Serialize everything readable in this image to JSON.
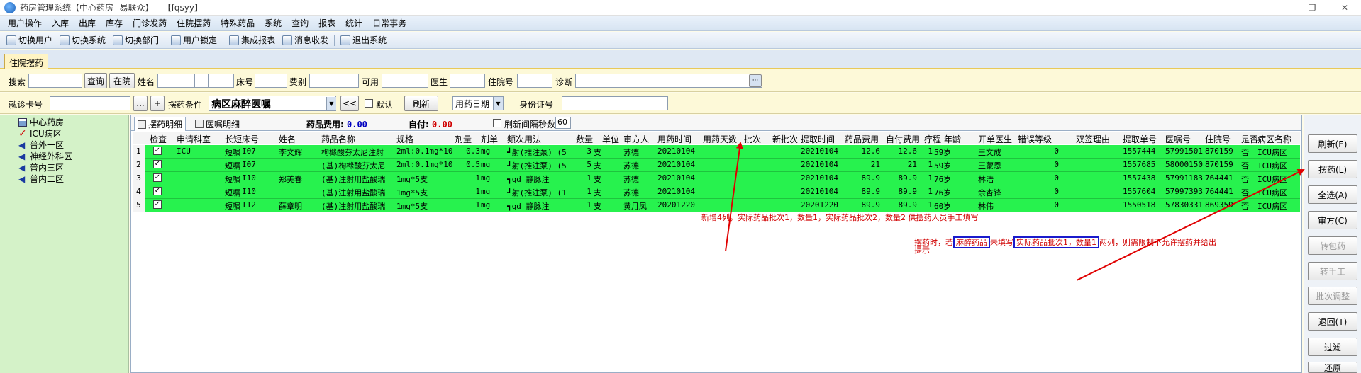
{
  "window": {
    "title": "药房管理系统【中心药房--易联众】---【fqsyy】",
    "minimize": "—",
    "restore": "❐",
    "close": "✕"
  },
  "menu": [
    "用户操作",
    "入库",
    "出库",
    "库存",
    "门诊发药",
    "住院摆药",
    "特殊药品",
    "系统",
    "查询",
    "报表",
    "统计",
    "日常事务"
  ],
  "toolbar": [
    "切换用户",
    "切换系统",
    "切换部门",
    "用户锁定",
    "集成报表",
    "消息收发",
    "退出系统"
  ],
  "doc_tab": "住院摆药",
  "filter1": {
    "search_label": "搜索",
    "search_value": "",
    "query_btn": "查询",
    "inhosp_btn": "在院",
    "name_label": "姓名",
    "bed_label": "床号",
    "fee_label": "费别",
    "avail_label": "可用",
    "doctor_label": "医生",
    "inpatient_label": "住院号",
    "diag_label": "诊断",
    "more_btn": "···"
  },
  "filter2": {
    "card_label": "就诊卡号",
    "dots_btn": "...",
    "plus_btn": "+",
    "cond_label": "摆药条件",
    "cond_value": "病区麻醉医嘱",
    "back_btn": "<<",
    "default_label": "默认",
    "refresh_btn": "刷新",
    "date_value": "用药日期",
    "id_label": "身份证号"
  },
  "tree": {
    "root": "中心药房",
    "items": [
      "ICU病区",
      "普外一区",
      "神经外科区",
      "普内三区",
      "普内二区"
    ]
  },
  "subtabs": {
    "tab1": "摆药明细",
    "tab2": "医嘱明细"
  },
  "summary": {
    "fee_label": "药品费用:",
    "fee_value": "0.00",
    "self_label": "自付:",
    "self_value": "0.00",
    "interval_label": "刷新间隔秒数",
    "interval_value": "60"
  },
  "grid": {
    "headers": [
      "检查",
      "申请科室",
      "长短",
      "床号",
      "姓名",
      "药品名称",
      "规格",
      "剂量",
      "剂单",
      "频次用法",
      "数量",
      "单位",
      "审方人",
      "用药时间",
      "用药天数",
      "批次",
      "新批次",
      "提取时间",
      "药品费用",
      "自付费用",
      "疗程",
      "年龄",
      "开单医生",
      "错误等级",
      "双签理由",
      "提取单号",
      "医嘱号",
      "住院号",
      "是否",
      "病区名称"
    ],
    "rows": [
      {
        "n": "1",
        "dept": "ICU",
        "type": "短嘱",
        "bed": "I07",
        "name": "李文辉",
        "drug": "枸橼酸芬太尼注射",
        "spec": "2ml:0.1mg*10",
        "dose": "0.3",
        "unit": "mg",
        "freq": "┛射(推注泵) (5",
        "qty": "3",
        "u": "支",
        "aud": "苏德",
        "time": "20210104",
        "ext": "20210104",
        "fee": "12.6",
        "self": "12.6",
        "course": "1",
        "age": "59岁",
        "doc": "王文成",
        "err": "0",
        "bill": "1557444",
        "order": "57991501",
        "inp": "870159",
        "flag": "否",
        "ward": "ICU病区"
      },
      {
        "n": "2",
        "dept": "",
        "type": "短嘱",
        "bed": "I07",
        "name": "",
        "drug": "(基)枸橼酸芬太尼",
        "spec": "2ml:0.1mg*10",
        "dose": "0.5",
        "unit": "mg",
        "freq": "┛射(推注泵) (5",
        "qty": "5",
        "u": "支",
        "aud": "苏德",
        "time": "20210104",
        "ext": "20210104",
        "fee": "21",
        "self": "21",
        "course": "1",
        "age": "59岁",
        "doc": "王蒙恩",
        "err": "0",
        "bill": "1557685",
        "order": "58000150",
        "inp": "870159",
        "flag": "否",
        "ward": "ICU病区"
      },
      {
        "n": "3",
        "dept": "",
        "type": "短嘱",
        "bed": "I10",
        "name": "郑美春",
        "drug": "(基)注射用盐酸瑞",
        "spec": "1mg*5支",
        "dose": "1",
        "unit": "mg",
        "freq": "┓qd 静脉注",
        "qty": "1",
        "u": "支",
        "aud": "苏德",
        "time": "20210104",
        "ext": "20210104",
        "fee": "89.9",
        "self": "89.9",
        "course": "1",
        "age": "76岁",
        "doc": "林浩",
        "err": "0",
        "bill": "1557438",
        "order": "57991183",
        "inp": "764441",
        "flag": "否",
        "ward": "ICU病区"
      },
      {
        "n": "4",
        "dept": "",
        "type": "短嘱",
        "bed": "I10",
        "name": "",
        "drug": "(基)注射用盐酸瑞",
        "spec": "1mg*5支",
        "dose": "1",
        "unit": "mg",
        "freq": "┛射(推注泵) (1",
        "qty": "1",
        "u": "支",
        "aud": "苏德",
        "time": "20210104",
        "ext": "20210104",
        "fee": "89.9",
        "self": "89.9",
        "course": "1",
        "age": "76岁",
        "doc": "余杏锋",
        "err": "0",
        "bill": "1557604",
        "order": "57997393",
        "inp": "764441",
        "flag": "否",
        "ward": "ICU病区"
      },
      {
        "n": "5",
        "dept": "",
        "type": "短嘱",
        "bed": "I12",
        "name": "薛章明",
        "drug": "(基)注射用盐酸瑞",
        "spec": "1mg*5支",
        "dose": "1",
        "unit": "mg",
        "freq": "┓qd 静脉注",
        "qty": "1",
        "u": "支",
        "aud": "黄月凤",
        "time": "20201220",
        "ext": "20201220",
        "fee": "89.9",
        "self": "89.9",
        "course": "1",
        "age": "60岁",
        "doc": "林伟",
        "err": "0",
        "bill": "1550518",
        "order": "57830331",
        "inp": "869359",
        "flag": "否",
        "ward": "ICU病区"
      }
    ]
  },
  "annotations": {
    "note1": "新增4列，实际药品批次1，数量1，实际药品批次2，数量2 供摆药人员手工填写",
    "note2_a": "摆药时，若",
    "note2_box1": "麻醉药品",
    "note2_b": "未填写",
    "note2_box2": "实际药品批次1，数量1",
    "note2_c": "两列，则需限制不允许摆药并给出",
    "note2_d": "提示",
    "color": "#d00000"
  },
  "right_buttons": [
    {
      "label": "刷新(E)",
      "enabled": true
    },
    {
      "label": "摆药(L)",
      "enabled": true
    },
    {
      "label": "全选(A)",
      "enabled": true
    },
    {
      "label": "审方(C)",
      "enabled": true
    },
    {
      "label": "转包药",
      "enabled": false
    },
    {
      "label": "转手工",
      "enabled": false
    },
    {
      "label": "批次调整",
      "enabled": false
    },
    {
      "label": "退回(T)",
      "enabled": true
    },
    {
      "label": "过滤",
      "enabled": true
    },
    {
      "label": "还原",
      "enabled": true
    }
  ],
  "colors": {
    "row_green": "#27f24e",
    "tree_bg": "#d4f2c8",
    "filter_bg": "#fdf9d8",
    "arrow": "#e00000",
    "box": "#1a1acc"
  }
}
